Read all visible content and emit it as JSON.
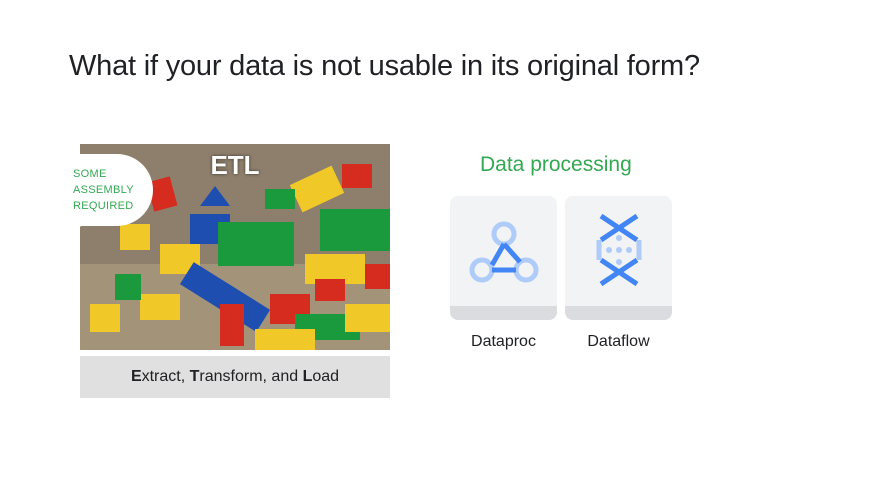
{
  "slide": {
    "title": "What if your data is not usable in its original form?"
  },
  "etl": {
    "image_label": "ETL",
    "bubble_lines": [
      "SOME",
      "ASSEMBLY",
      "REQUIRED"
    ],
    "caption": {
      "extract_initial": "E",
      "extract_rest": "xtract, ",
      "transform_initial": "T",
      "transform_rest": "ransform, and ",
      "load_initial": "L",
      "load_rest": "oad"
    }
  },
  "processing": {
    "title": "Data processing",
    "products": [
      {
        "label": "Dataproc",
        "icon": "dataproc-icon"
      },
      {
        "label": "Dataflow",
        "icon": "dataflow-icon"
      }
    ]
  },
  "colors": {
    "accent_green": "#34a853",
    "icon_blue": "#4285f4",
    "icon_light_blue": "#aecbfa"
  }
}
